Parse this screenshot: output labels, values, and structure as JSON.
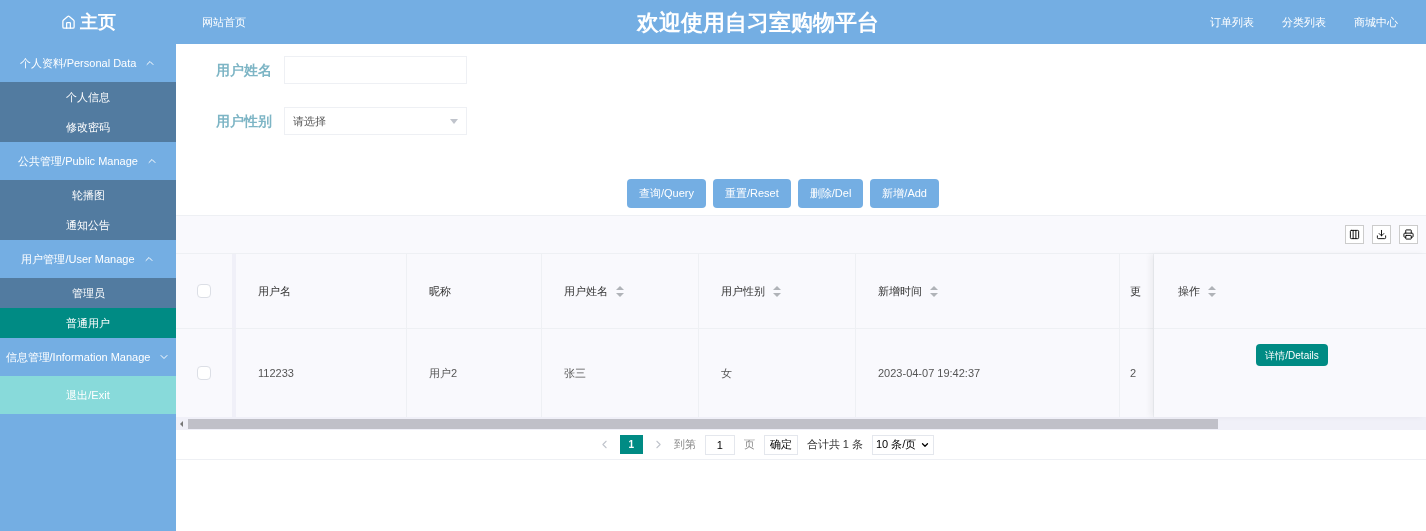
{
  "header": {
    "home": "主页",
    "links": [
      {
        "label": "网站首页"
      }
    ],
    "title": "欢迎使用自习室购物平台",
    "right_links": [
      {
        "label": "订单列表"
      },
      {
        "label": "分类列表"
      },
      {
        "label": "商城中心"
      }
    ]
  },
  "sidebar": {
    "groups": [
      {
        "label": "个人资料/Personal Data",
        "expanded": true,
        "items": [
          {
            "label": "个人信息",
            "selected": false
          },
          {
            "label": "修改密码",
            "selected": false
          }
        ]
      },
      {
        "label": "公共管理/Public Manage",
        "expanded": true,
        "items": [
          {
            "label": "轮播图",
            "selected": false
          },
          {
            "label": "通知公告",
            "selected": false
          }
        ]
      },
      {
        "label": "用户管理/User Manage",
        "expanded": true,
        "items": [
          {
            "label": "管理员",
            "selected": false
          },
          {
            "label": "普通用户",
            "selected": true
          }
        ]
      },
      {
        "label": "信息管理/Information Manage",
        "expanded": false
      }
    ],
    "exit": "退出/Exit"
  },
  "search": {
    "fields": [
      {
        "kind": "input",
        "label": "用户姓名"
      },
      {
        "kind": "select",
        "label": "用户性别",
        "placeholder": "请选择"
      }
    ]
  },
  "buttons": [
    "查询/Query",
    "重置/Reset",
    "删除/Del",
    "新增/Add"
  ],
  "table": {
    "columns": [
      {
        "label": "用户名",
        "sortable": false
      },
      {
        "label": "昵称",
        "sortable": false
      },
      {
        "label": "用户姓名",
        "sortable": true
      },
      {
        "label": "用户性别",
        "sortable": true
      },
      {
        "label": "新增时间",
        "sortable": true
      },
      {
        "label": "更",
        "sortable": false
      }
    ],
    "action_column": {
      "label": "操作",
      "sortable": true
    },
    "rows": [
      {
        "checked": false,
        "cells": [
          "112233",
          "用户2",
          "张三",
          "女",
          "2023-04-07 19:42:37",
          "2"
        ],
        "action": "详情/Details"
      }
    ],
    "all_checked": false
  },
  "pagination": {
    "page": "1",
    "goto_label": "到第",
    "goto_value": "1",
    "page_unit": "页",
    "confirm": "确定",
    "total": "合计共 1 条",
    "page_size": "10 条/页"
  }
}
